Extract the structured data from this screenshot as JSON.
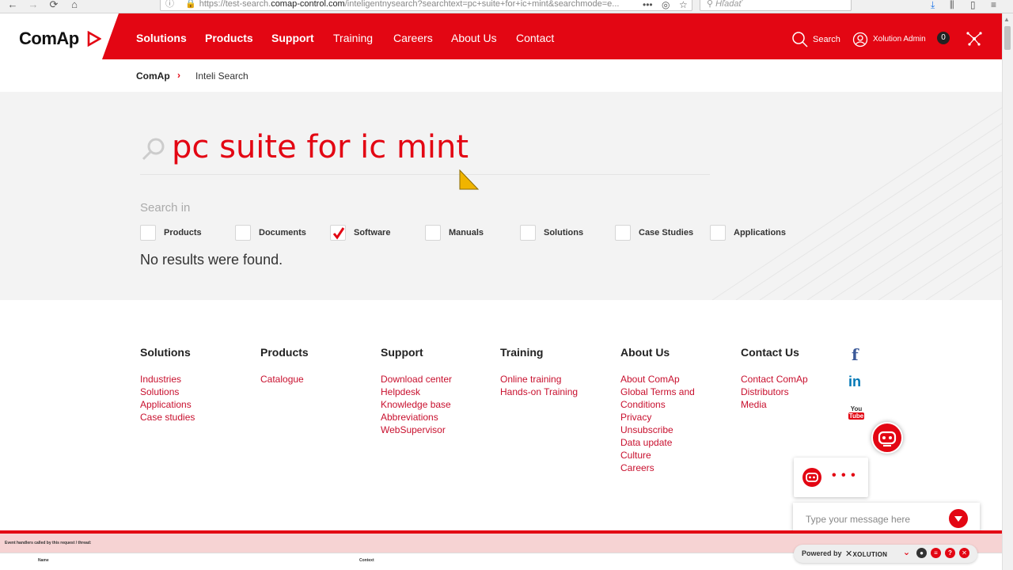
{
  "browser": {
    "back": "←",
    "forward": "→",
    "reload": "⟳",
    "home": "⌂",
    "info": "ⓘ",
    "url_prefix": "https://test-search.",
    "url_host": "comap-control.com",
    "url_rest": "/inteligentnysearch?searchtext=pc+suite+for+ic+mint&searchmode=e...",
    "more": "•••",
    "search_placeholder": "Hľadať"
  },
  "header": {
    "logo": "ComAp",
    "nav": [
      {
        "label": "Solutions"
      },
      {
        "label": "Products"
      },
      {
        "label": "Support"
      },
      {
        "label": "Training"
      },
      {
        "label": "Careers"
      },
      {
        "label": "About Us"
      },
      {
        "label": "Contact"
      }
    ],
    "search_label": "Search",
    "user_label": "Xolution Admin",
    "cart_count": "0"
  },
  "breadcrumb": {
    "home": "ComAp",
    "separator": "›",
    "current": "Inteli Search"
  },
  "search": {
    "query": "pc suite for ic mint",
    "search_in_label": "Search in",
    "filters": [
      {
        "label": "Products",
        "checked": false
      },
      {
        "label": "Documents",
        "checked": false
      },
      {
        "label": "Software",
        "checked": true
      },
      {
        "label": "Manuals",
        "checked": false
      },
      {
        "label": "Solutions",
        "checked": false
      },
      {
        "label": "Case Studies",
        "checked": false
      },
      {
        "label": "Applications",
        "checked": false
      }
    ],
    "no_results": "No results were found."
  },
  "footer": {
    "columns": [
      {
        "title": "Solutions",
        "links": [
          "Industries",
          "Solutions",
          "Applications",
          "Case studies"
        ]
      },
      {
        "title": "Products",
        "links": [
          "Catalogue"
        ]
      },
      {
        "title": "Support",
        "links": [
          "Download center",
          "Helpdesk",
          "Knowledge base",
          "Abbreviations",
          "WebSupervisor"
        ]
      },
      {
        "title": "Training",
        "links": [
          "Online training",
          "Hands-on Training"
        ]
      },
      {
        "title": "About Us",
        "links": [
          "About ComAp",
          "Global Terms and",
          "Conditions",
          "Privacy",
          "Unsubscribe",
          "Data update",
          "Culture",
          "Careers"
        ]
      },
      {
        "title": "Contact Us",
        "links": [
          "Contact ComAp",
          "Distributors",
          "Media"
        ]
      }
    ],
    "social": {
      "facebook": "f",
      "linkedin": "in",
      "youtube_top": "You",
      "youtube_bottom": "Tube"
    }
  },
  "chat": {
    "typing_dots": "• • •",
    "input_placeholder": "Type your message here",
    "powered_by": "Powered by",
    "brand": "XOLUTION"
  },
  "debug": {
    "text": "Event handlers called by this request / thread:",
    "col_name": "Name",
    "col_context": "Context"
  },
  "colors": {
    "brand_red": "#e30613",
    "link_red": "#c8102e"
  }
}
